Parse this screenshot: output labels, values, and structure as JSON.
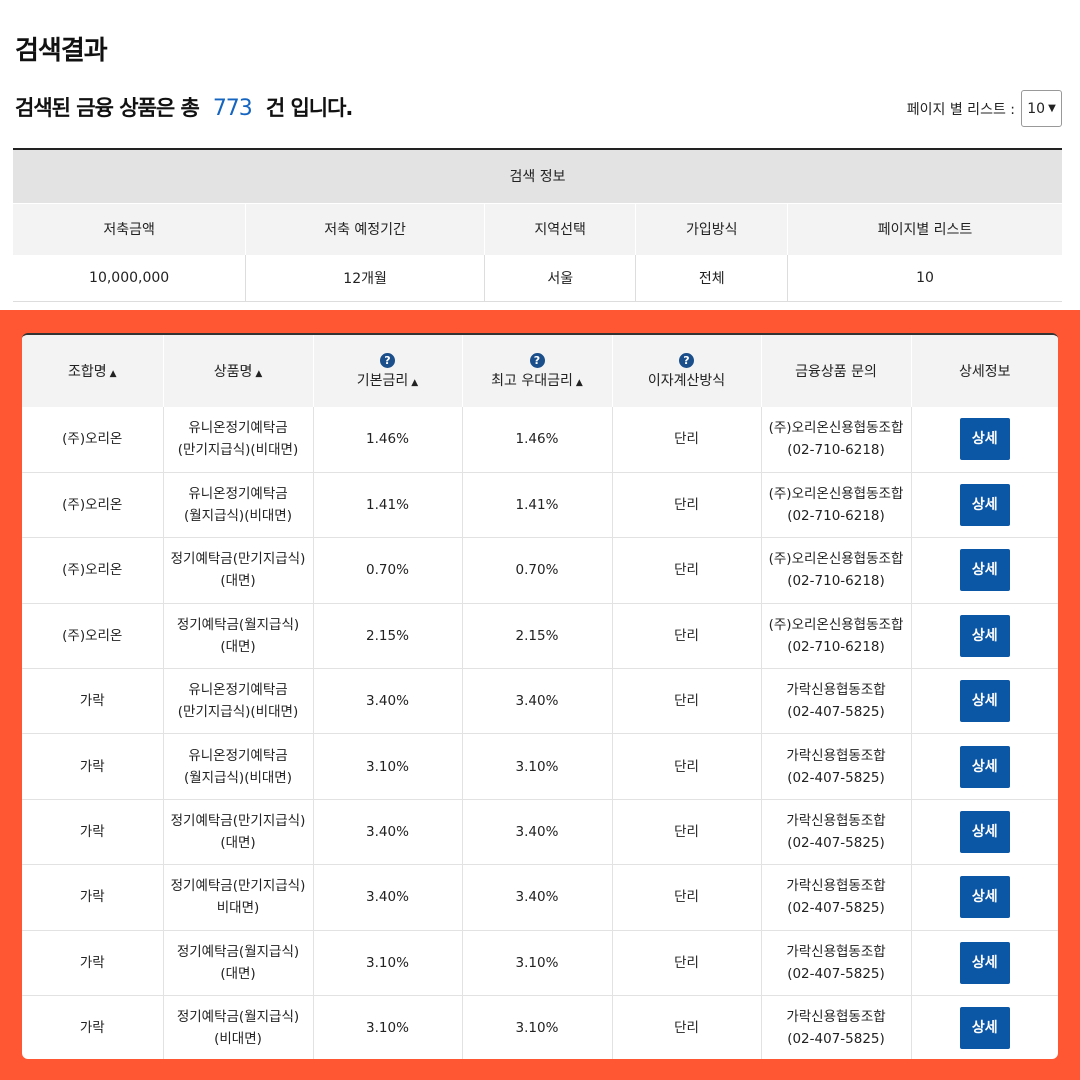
{
  "page": {
    "title": "검색결과"
  },
  "summary": {
    "prefix": "검색된 금융 상품은 총",
    "count": "773",
    "suffix": "건 입니다."
  },
  "per_page": {
    "label": "페이지 별 리스트 :",
    "value": "10"
  },
  "search_info": {
    "title": "검색 정보",
    "headers": [
      "저축금액",
      "저축 예정기간",
      "지역선택",
      "가입방식",
      "페이지별 리스트"
    ],
    "values": [
      "10,000,000",
      "12개월",
      "서울",
      "전체",
      "10"
    ]
  },
  "results": {
    "headers": {
      "union": "조합명",
      "product": "상품명",
      "base_rate": "기본금리",
      "max_rate": "최고 우대금리",
      "interest": "이자계산방식",
      "inquiry": "금융상품 문의",
      "detail": "상세정보"
    },
    "detail_label": "상세",
    "rows": [
      {
        "union": "(주)오리온",
        "product1": "유니온정기예탁금",
        "product2": "(만기지급식)(비대면)",
        "base": "1.46%",
        "max": "1.46%",
        "interest": "단리",
        "contact1": "(주)오리온신용협동조합",
        "contact2": "(02-710-6218)"
      },
      {
        "union": "(주)오리온",
        "product1": "유니온정기예탁금",
        "product2": "(월지급식)(비대면)",
        "base": "1.41%",
        "max": "1.41%",
        "interest": "단리",
        "contact1": "(주)오리온신용협동조합",
        "contact2": "(02-710-6218)"
      },
      {
        "union": "(주)오리온",
        "product1": "정기예탁금(만기지급식)",
        "product2": "(대면)",
        "base": "0.70%",
        "max": "0.70%",
        "interest": "단리",
        "contact1": "(주)오리온신용협동조합",
        "contact2": "(02-710-6218)"
      },
      {
        "union": "(주)오리온",
        "product1": "정기예탁금(월지급식)",
        "product2": "(대면)",
        "base": "2.15%",
        "max": "2.15%",
        "interest": "단리",
        "contact1": "(주)오리온신용협동조합",
        "contact2": "(02-710-6218)"
      },
      {
        "union": "가락",
        "product1": "유니온정기예탁금",
        "product2": "(만기지급식)(비대면)",
        "base": "3.40%",
        "max": "3.40%",
        "interest": "단리",
        "contact1": "가락신용협동조합",
        "contact2": "(02-407-5825)"
      },
      {
        "union": "가락",
        "product1": "유니온정기예탁금",
        "product2": "(월지급식)(비대면)",
        "base": "3.10%",
        "max": "3.10%",
        "interest": "단리",
        "contact1": "가락신용협동조합",
        "contact2": "(02-407-5825)"
      },
      {
        "union": "가락",
        "product1": "정기예탁금(만기지급식)",
        "product2": "(대면)",
        "base": "3.40%",
        "max": "3.40%",
        "interest": "단리",
        "contact1": "가락신용협동조합",
        "contact2": "(02-407-5825)"
      },
      {
        "union": "가락",
        "product1": "정기예탁금(만기지급식)",
        "product2": "비대면)",
        "base": "3.40%",
        "max": "3.40%",
        "interest": "단리",
        "contact1": "가락신용협동조합",
        "contact2": "(02-407-5825)"
      },
      {
        "union": "가락",
        "product1": "정기예탁금(월지급식)",
        "product2": "(대면)",
        "base": "3.10%",
        "max": "3.10%",
        "interest": "단리",
        "contact1": "가락신용협동조합",
        "contact2": "(02-407-5825)"
      },
      {
        "union": "가락",
        "product1": "정기예탁금(월지급식)",
        "product2": "(비대면)",
        "base": "3.10%",
        "max": "3.10%",
        "interest": "단리",
        "contact1": "가락신용협동조합",
        "contact2": "(02-407-5825)"
      }
    ]
  },
  "colors": {
    "highlight_frame": "#ff5733",
    "accent_blue": "#1565c0",
    "button_blue": "#0b56a5"
  },
  "icons": {
    "help": "question-circle-icon",
    "sort": "sort-up-icon",
    "dropdown": "chevron-down-icon"
  }
}
